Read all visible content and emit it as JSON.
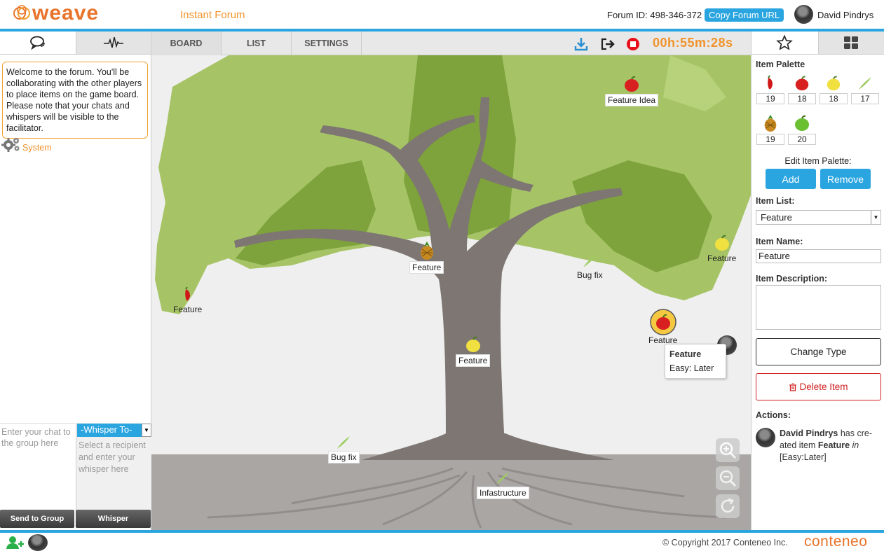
{
  "header": {
    "app_name": "weave",
    "forum_type": "Instant Forum",
    "forum_id": "Forum ID: 498-346-372",
    "copy_button": "Copy Forum URL",
    "user_name": "David Pindrys"
  },
  "left_panel": {
    "tabs": [
      {
        "icon": "chat-bubbles-icon"
      },
      {
        "icon": "activity-pulse-icon"
      }
    ],
    "welcome_message": "Welcome to the forum. You'll be collaborating with the other players to place items on the game board. Please note that your chats and whispers will be visible to the facilitator.",
    "system_label": "System",
    "chat_placeholder": "Enter your chat to the group here",
    "whisper_select": "-Whisper To-",
    "whisper_placeholder": "Select a recipient and enter your whisper here",
    "send_group_button": "Send to Group",
    "whisper_button": "Whisper"
  },
  "board": {
    "tabs": [
      "BOARD",
      "LIST",
      "SETTINGS"
    ],
    "active_tab": "BOARD",
    "timer": "00h:55m:28s",
    "items": [
      {
        "label": "Feature Idea",
        "icon": "red-apple-icon"
      },
      {
        "label": "Feature",
        "icon": "pineapple-icon"
      },
      {
        "label": "Feature",
        "icon": "yellow-apple-icon"
      },
      {
        "label": "Bug fix",
        "icon": "leaf-icon"
      },
      {
        "label": "Feature",
        "icon": "chili-pepper-icon"
      },
      {
        "label": "Feature",
        "icon": "red-apple-icon"
      },
      {
        "label": "Feature",
        "icon": "yellow-apple-icon"
      },
      {
        "label": "Bug fix",
        "icon": "leaf-icon"
      },
      {
        "label": "Infastructure",
        "icon": "leaf-icon"
      }
    ],
    "tooltip": {
      "title": "Feature",
      "value": "Easy: Later"
    },
    "colors": {
      "canopy_light": "#a6c466",
      "canopy_dark": "#7ea23c",
      "trunk": "#7d7672",
      "ground": "#a9a6a3"
    }
  },
  "right_panel": {
    "tabs": [
      {
        "icon": "star-icon"
      },
      {
        "icon": "grid-icon"
      }
    ],
    "palette_title": "Item Palette",
    "palette": [
      {
        "icon": "chili-pepper-icon",
        "count": "19"
      },
      {
        "icon": "red-apple-icon",
        "count": "18"
      },
      {
        "icon": "yellow-apple-icon",
        "count": "18"
      },
      {
        "icon": "leaf-icon",
        "count": "17"
      },
      {
        "icon": "pineapple-icon",
        "count": "19"
      },
      {
        "icon": "green-apple-icon",
        "count": "20"
      }
    ],
    "edit_palette_label": "Edit Item Palette:",
    "add_button": "Add",
    "remove_button": "Remove",
    "item_list_label": "Item List:",
    "item_list_value": "Feature",
    "item_name_label": "Item Name:",
    "item_name_value": "Feature",
    "item_description_label": "Item Description:",
    "change_type_button": "Change Type",
    "delete_item_button": "Delete Item",
    "actions_label": "Actions:",
    "action_user": "David Pindrys",
    "action_text_1": " has cre-ated item ",
    "action_item": "Feature",
    "action_in": " in",
    "action_bucket": "[Easy:Later]"
  },
  "footer": {
    "copyright": "© Copyright 2017 Conteneo Inc.",
    "brand": "conteneo"
  }
}
